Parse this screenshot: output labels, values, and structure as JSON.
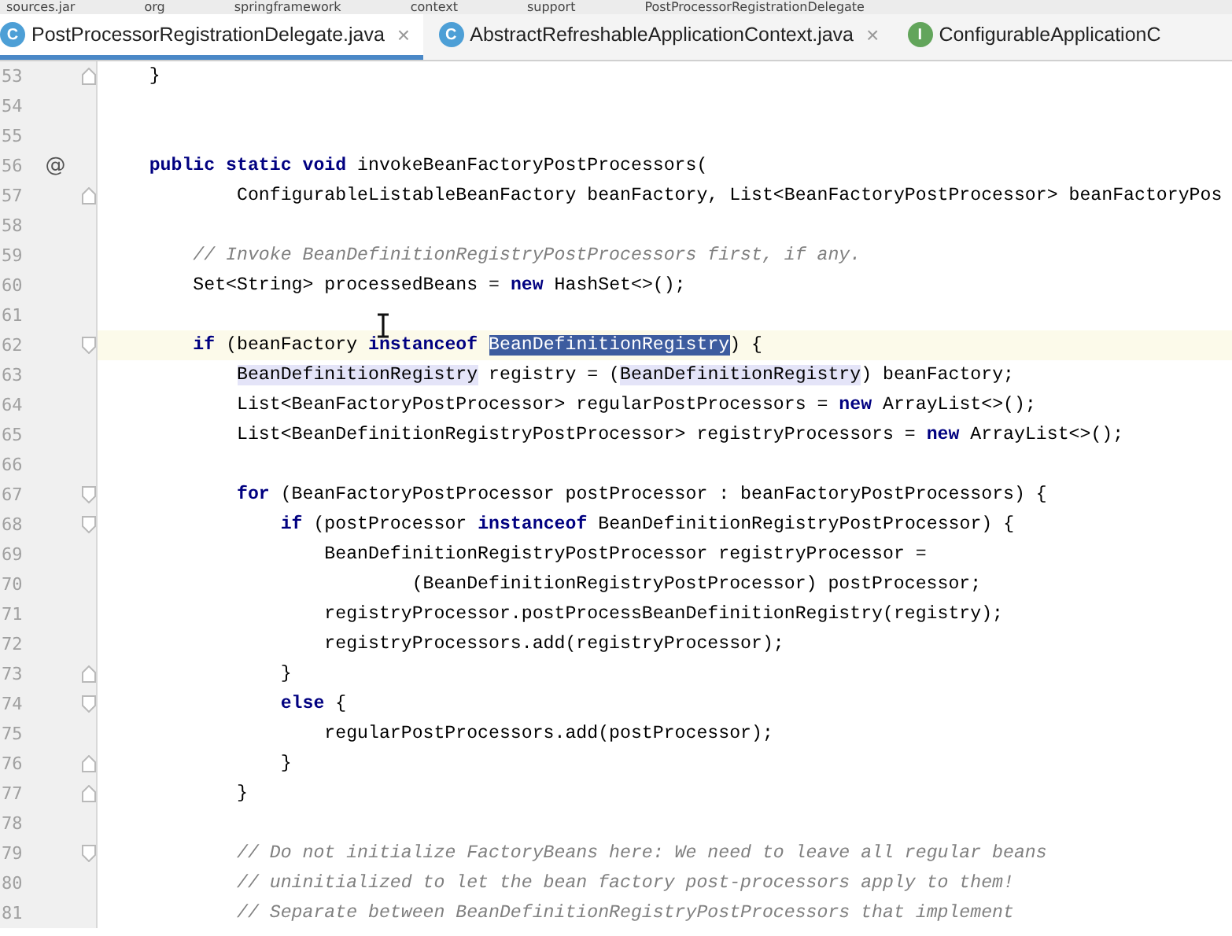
{
  "breadcrumbs": [
    {
      "label": "sources.jar"
    },
    {
      "label": "org"
    },
    {
      "label": "springframework"
    },
    {
      "label": "context"
    },
    {
      "label": "support"
    },
    {
      "label": "PostProcessorRegistrationDelegate"
    }
  ],
  "tabs": [
    {
      "label": "PostProcessorRegistrationDelegate.java",
      "icon_letter": "C",
      "kind": "class",
      "selected": true,
      "close": "×"
    },
    {
      "label": "AbstractRefreshableApplicationContext.java",
      "icon_letter": "C",
      "kind": "class",
      "selected": false,
      "close": "×"
    },
    {
      "label": "ConfigurableApplicationC",
      "icon_letter": "I",
      "kind": "interface",
      "selected": false
    }
  ],
  "lines": [
    {
      "number": "53",
      "fold": {
        "kind": "end"
      },
      "current": false,
      "tokens": [
        {
          "kind": "text",
          "text": "    }"
        }
      ]
    },
    {
      "number": "54",
      "current": false
    },
    {
      "number": "55",
      "current": false
    },
    {
      "number": "56",
      "gutter_mark": "@",
      "current": false,
      "tokens": [
        {
          "kind": "keyword",
          "text": "    public static void"
        },
        {
          "kind": "text",
          "text": " invokeBeanFactoryPostProcessors("
        }
      ]
    },
    {
      "number": "57",
      "fold": {
        "kind": "end"
      },
      "current": false,
      "tokens": [
        {
          "kind": "text",
          "text": "            ConfigurableListableBeanFactory beanFactory, List<BeanFactoryPostProcessor> beanFactoryPos"
        }
      ]
    },
    {
      "number": "58",
      "current": false
    },
    {
      "number": "59",
      "current": false,
      "tokens": [
        {
          "kind": "comment",
          "text": "        // Invoke BeanDefinitionRegistryPostProcessors first, if any."
        }
      ]
    },
    {
      "number": "60",
      "current": false,
      "tokens": [
        {
          "kind": "text",
          "text": "        Set<String> processedBeans = "
        },
        {
          "kind": "keyword",
          "text": "new"
        },
        {
          "kind": "text",
          "text": " HashSet<>();"
        }
      ]
    },
    {
      "number": "61",
      "current": false
    },
    {
      "number": "62",
      "fold": {
        "kind": "start"
      },
      "current": true,
      "tokens": [
        {
          "kind": "keyword",
          "text": "        if"
        },
        {
          "kind": "text",
          "text": " (beanFactory "
        },
        {
          "kind": "keyword",
          "text": "instanceof "
        },
        {
          "kind": "selection",
          "text": "BeanDefinitionRegistry"
        },
        {
          "kind": "text",
          "text": ") {"
        }
      ]
    },
    {
      "number": "63",
      "current": false,
      "tokens": [
        {
          "kind": "usage",
          "text": "            BeanDefinitionRegistry"
        },
        {
          "kind": "text",
          "text": " registry = ("
        },
        {
          "kind": "usage",
          "text": "BeanDefinitionRegistry"
        },
        {
          "kind": "text",
          "text": ") beanFactory;"
        }
      ]
    },
    {
      "number": "64",
      "current": false,
      "tokens": [
        {
          "kind": "text",
          "text": "            List<BeanFactoryPostProcessor> regularPostProcessors = "
        },
        {
          "kind": "keyword",
          "text": "new"
        },
        {
          "kind": "text",
          "text": " ArrayList<>();"
        }
      ]
    },
    {
      "number": "65",
      "current": false,
      "tokens": [
        {
          "kind": "text",
          "text": "            List<BeanDefinitionRegistryPostProcessor> registryProcessors = "
        },
        {
          "kind": "keyword",
          "text": "new"
        },
        {
          "kind": "text",
          "text": " ArrayList<>();"
        }
      ]
    },
    {
      "number": "66",
      "current": false
    },
    {
      "number": "67",
      "fold": {
        "kind": "start"
      },
      "current": false,
      "tokens": [
        {
          "kind": "keyword",
          "text": "            for"
        },
        {
          "kind": "text",
          "text": " (BeanFactoryPostProcessor postProcessor : beanFactoryPostProcessors) {"
        }
      ]
    },
    {
      "number": "68",
      "fold": {
        "kind": "start"
      },
      "current": false,
      "tokens": [
        {
          "kind": "keyword",
          "text": "                if"
        },
        {
          "kind": "text",
          "text": " (postProcessor "
        },
        {
          "kind": "keyword",
          "text": "instanceof"
        },
        {
          "kind": "text",
          "text": " BeanDefinitionRegistryPostProcessor) {"
        }
      ]
    },
    {
      "number": "69",
      "current": false,
      "tokens": [
        {
          "kind": "text",
          "text": "                    BeanDefinitionRegistryPostProcessor registryProcessor ="
        }
      ]
    },
    {
      "number": "70",
      "current": false,
      "tokens": [
        {
          "kind": "text",
          "text": "                            (BeanDefinitionRegistryPostProcessor) postProcessor;"
        }
      ]
    },
    {
      "number": "71",
      "current": false,
      "tokens": [
        {
          "kind": "text",
          "text": "                    registryProcessor.postProcessBeanDefinitionRegistry(registry);"
        }
      ]
    },
    {
      "number": "72",
      "current": false,
      "tokens": [
        {
          "kind": "text",
          "text": "                    registryProcessors.add(registryProcessor);"
        }
      ]
    },
    {
      "number": "73",
      "fold": {
        "kind": "end"
      },
      "current": false,
      "tokens": [
        {
          "kind": "text",
          "text": "                }"
        }
      ]
    },
    {
      "number": "74",
      "fold": {
        "kind": "start"
      },
      "current": false,
      "tokens": [
        {
          "kind": "keyword",
          "text": "                else"
        },
        {
          "kind": "text",
          "text": " {"
        }
      ]
    },
    {
      "number": "75",
      "current": false,
      "tokens": [
        {
          "kind": "text",
          "text": "                    regularPostProcessors.add(postProcessor);"
        }
      ]
    },
    {
      "number": "76",
      "fold": {
        "kind": "end"
      },
      "current": false,
      "tokens": [
        {
          "kind": "text",
          "text": "                }"
        }
      ]
    },
    {
      "number": "77",
      "fold": {
        "kind": "end"
      },
      "current": false,
      "tokens": [
        {
          "kind": "text",
          "text": "            }"
        }
      ]
    },
    {
      "number": "78",
      "current": false
    },
    {
      "number": "79",
      "fold": {
        "kind": "start"
      },
      "current": false,
      "tokens": [
        {
          "kind": "comment",
          "text": "            // Do not initialize FactoryBeans here: We need to leave all regular beans"
        }
      ]
    },
    {
      "number": "80",
      "current": false,
      "tokens": [
        {
          "kind": "comment",
          "text": "            // uninitialized to let the bean factory post-processors apply to them!"
        }
      ]
    },
    {
      "number": "81",
      "current": false,
      "tokens": [
        {
          "kind": "comment",
          "text": "            // Separate between BeanDefinitionRegistryPostProcessors that implement"
        }
      ]
    }
  ]
}
